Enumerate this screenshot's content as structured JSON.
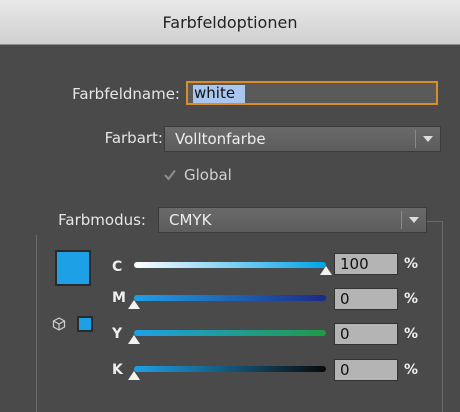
{
  "window": {
    "title": "Farbfeldoptionen"
  },
  "name": {
    "label": "Farbfeldname:",
    "value": "white"
  },
  "color_type": {
    "label": "Farbart:",
    "value": "Volltonfarbe"
  },
  "global": {
    "label": "Global",
    "checked": true
  },
  "mode": {
    "label": "Farbmodus:",
    "value": "CMYK"
  },
  "swatch_color": "#1ea0e6",
  "channels": [
    {
      "letter": "C",
      "value": "100",
      "unit": "%",
      "level": 1.0
    },
    {
      "letter": "M",
      "value": "0",
      "unit": "%",
      "level": 0.0
    },
    {
      "letter": "Y",
      "value": "0",
      "unit": "%",
      "level": 0.0
    },
    {
      "letter": "K",
      "value": "0",
      "unit": "%",
      "level": 0.0
    }
  ]
}
